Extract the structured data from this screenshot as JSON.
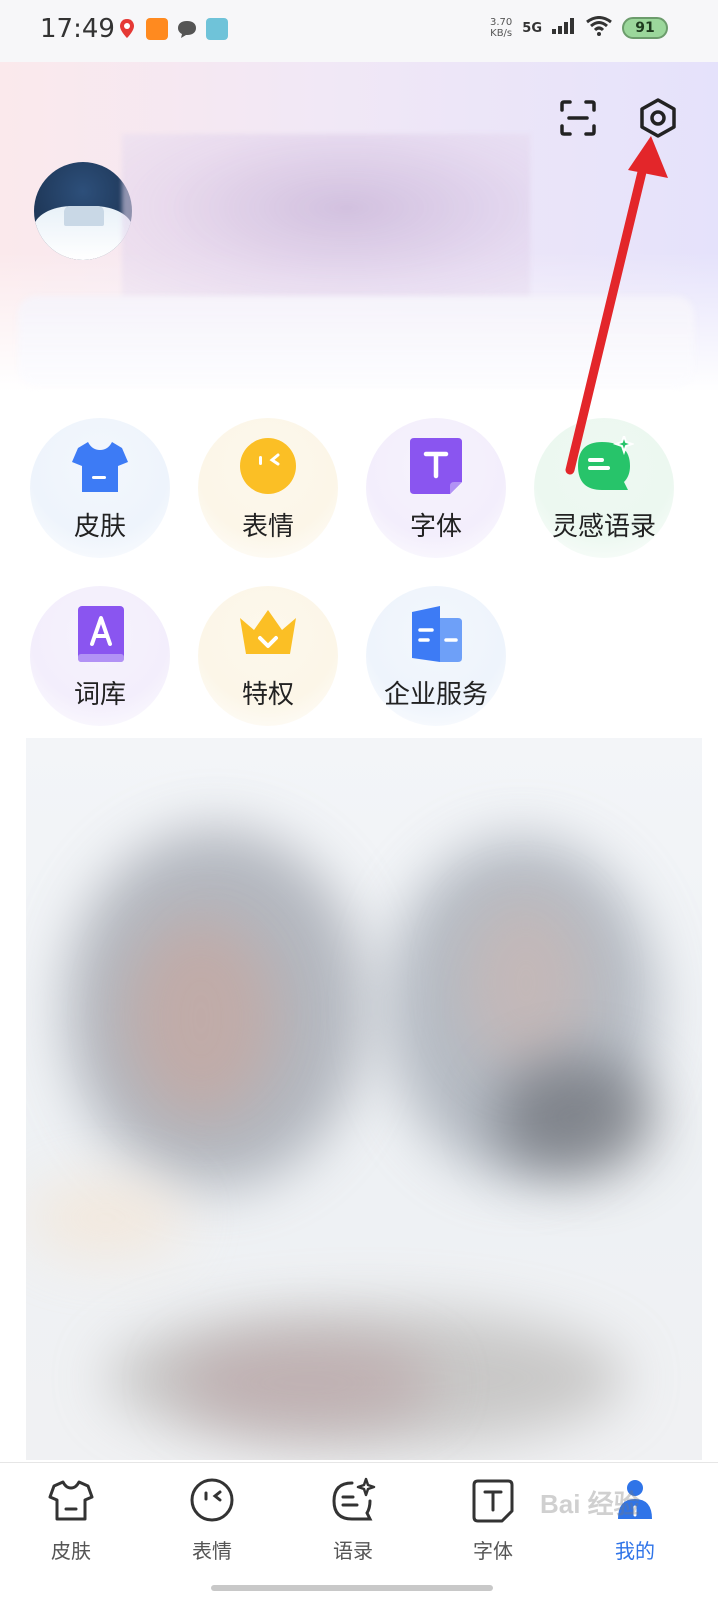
{
  "status_bar": {
    "time": "17:49",
    "notifications": [
      "maps-icon",
      "app-icon",
      "message-icon",
      "game-icon"
    ],
    "net_speed_value": "3.70",
    "net_speed_unit": "KB/s",
    "network": "5G",
    "battery": "91",
    "battery_color": "#9bd79b"
  },
  "header": {
    "scan_icon": "scan-icon",
    "settings_icon": "settings-icon"
  },
  "features": [
    {
      "label": "皮肤",
      "icon": "skin-tshirt-icon",
      "color": "#3d7bf5"
    },
    {
      "label": "表情",
      "icon": "emoji-face-icon",
      "color": "#fbbf25"
    },
    {
      "label": "字体",
      "icon": "font-t-icon",
      "color": "#8a55f0"
    },
    {
      "label": "灵感语录",
      "icon": "inspiration-quote-icon",
      "color": "#27c46a"
    },
    {
      "label": "词库",
      "icon": "dictionary-a-icon",
      "color": "#8a55f0"
    },
    {
      "label": "特权",
      "icon": "privilege-crown-icon",
      "color": "#fbbf25"
    },
    {
      "label": "企业服务",
      "icon": "enterprise-building-icon",
      "color": "#3d7bf5"
    }
  ],
  "bottom_nav": [
    {
      "label": "皮肤",
      "icon": "skin-tshirt-icon"
    },
    {
      "label": "表情",
      "icon": "emoji-face-icon"
    },
    {
      "label": "语录",
      "icon": "quote-icon"
    },
    {
      "label": "字体",
      "icon": "font-t-icon"
    },
    {
      "label": "我的",
      "icon": "profile-person-icon",
      "active": true
    }
  ],
  "accent_color": "#2f74e8",
  "annotation_arrow_color": "#e3262a",
  "watermark": "Bai 经验"
}
